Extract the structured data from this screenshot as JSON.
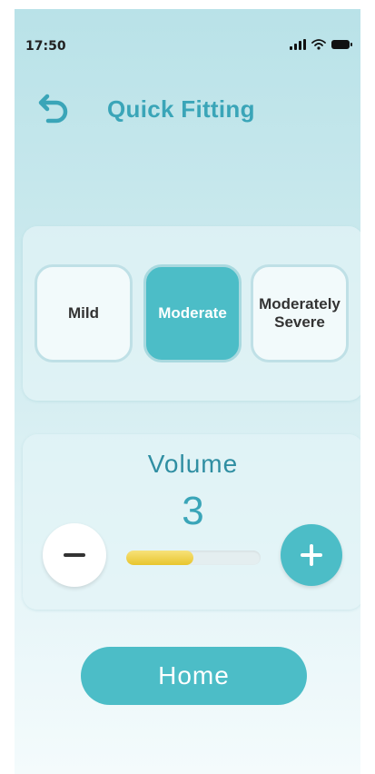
{
  "status_bar": {
    "time": "17:50",
    "icons": [
      "signal-icon",
      "wifi-icon",
      "battery-icon"
    ]
  },
  "header": {
    "title": "Quick Fitting",
    "back_icon": "back-arrow-icon"
  },
  "levels": [
    {
      "label": "Mild",
      "selected": false
    },
    {
      "label": "Moderate",
      "selected": true
    },
    {
      "label": "Moderately\nSevere",
      "selected": false
    }
  ],
  "volume": {
    "title": "Volume",
    "value": "3",
    "fill_fraction": 0.5,
    "minus_icon": "minus-icon",
    "plus_icon": "plus-icon"
  },
  "home_button": {
    "label": "Home"
  },
  "colors": {
    "accent": "#4cbdc7",
    "title": "#3aa5b8",
    "volume_fill": "#e8c52e"
  }
}
